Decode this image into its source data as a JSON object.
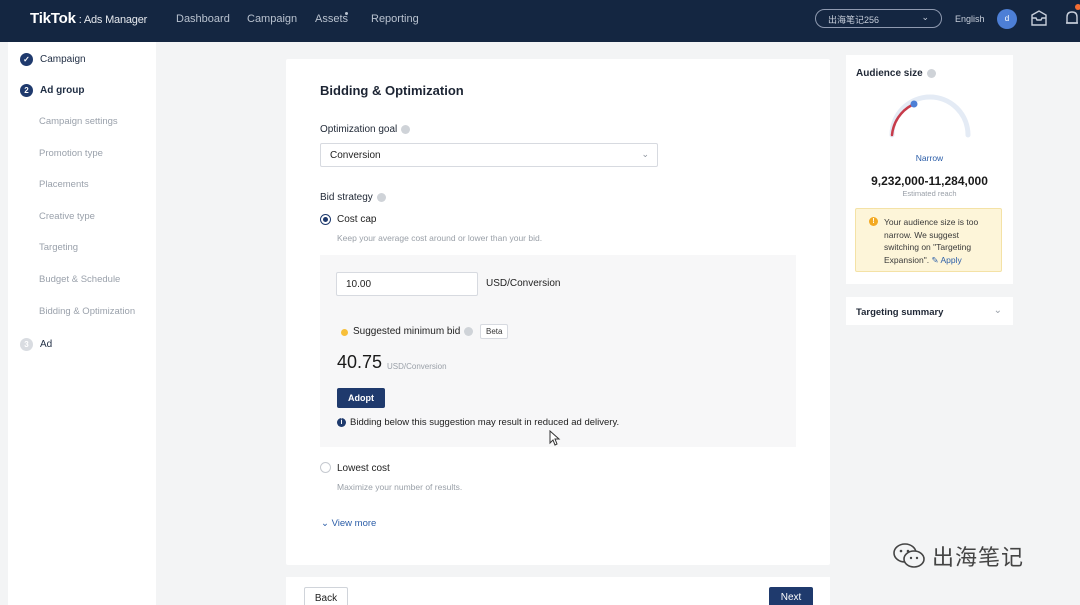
{
  "topbar": {
    "brand": "TikTok",
    "brand_sub": ": Ads Manager",
    "nav": [
      "Dashboard",
      "Campaign",
      "Assets",
      "Reporting"
    ],
    "account": "出海笔记256",
    "language": "English",
    "avatar_initial": "d"
  },
  "sidebar": {
    "steps": [
      {
        "label": "Campaign",
        "status": "done"
      },
      {
        "label": "Ad group",
        "status": "active",
        "number": "2"
      },
      {
        "label": "Ad",
        "status": "todo",
        "number": "3"
      }
    ],
    "substeps": [
      "Campaign settings",
      "Promotion type",
      "Placements",
      "Creative type",
      "Targeting",
      "Budget & Schedule",
      "Bidding & Optimization"
    ]
  },
  "main": {
    "title": "Bidding & Optimization",
    "optimization_goal_label": "Optimization goal",
    "optimization_goal_value": "Conversion",
    "bid_strategy_label": "Bid strategy",
    "cost_cap": {
      "label": "Cost cap",
      "hint": "Keep your average cost around or lower than your bid.",
      "bid_value": "10.00",
      "unit": "USD/Conversion",
      "suggested_label": "Suggested minimum bid",
      "beta": "Beta",
      "suggested_value": "40.75",
      "suggested_unit": "USD/Conversion",
      "adopt": "Adopt",
      "warning": "Bidding below this suggestion may result in reduced ad delivery."
    },
    "lowest_cost": {
      "label": "Lowest cost",
      "hint": "Maximize your number of results."
    },
    "view_more": "View more"
  },
  "footer": {
    "back": "Back",
    "next": "Next"
  },
  "audience": {
    "title": "Audience size",
    "level": "Narrow",
    "range": "9,232,000-11,284,000",
    "estimated": "Estimated reach",
    "notice": "Your audience size is too narrow. We suggest switching on \"Targeting Expansion\".",
    "apply": "Apply"
  },
  "targeting_summary": {
    "title": "Targeting summary"
  },
  "watermark": {
    "text": "出海笔记"
  },
  "colors": {
    "nav_bg": "#142641",
    "primary": "#1f3a6d",
    "link": "#2c5ea8",
    "warn": "#f3a922"
  }
}
